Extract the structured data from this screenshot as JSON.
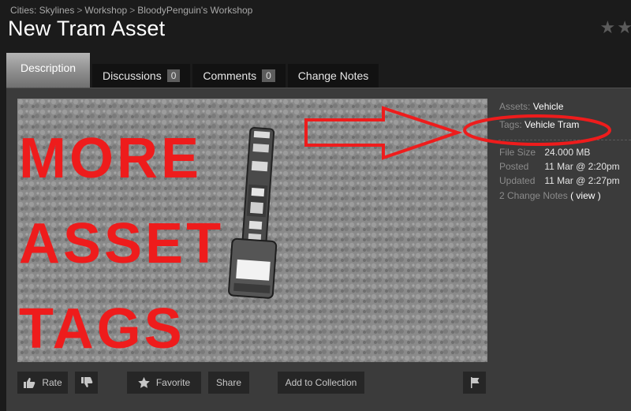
{
  "breadcrumb": {
    "game": "Cities: Skylines",
    "workshop": "Workshop",
    "author_workshop": "BloodyPenguin's Workshop",
    "separator": ">"
  },
  "page_title": "New Tram Asset",
  "rating": {
    "stars": "★★"
  },
  "tabs": [
    {
      "label": "Description",
      "active": true
    },
    {
      "label": "Discussions",
      "count": "0"
    },
    {
      "label": "Comments",
      "count": "0"
    },
    {
      "label": "Change Notes"
    }
  ],
  "overlay_text": [
    "MORE",
    "ASSET",
    "TAGS"
  ],
  "details": {
    "assets_label": "Assets:",
    "assets_value": "Vehicle",
    "tags_label": "Tags:",
    "tags": [
      "Vehicle",
      "Tram"
    ],
    "file_size_label": "File Size",
    "file_size": "24.000 MB",
    "posted_label": "Posted",
    "posted": "11 Mar @ 2:20pm",
    "updated_label": "Updated",
    "updated": "11 Mar @ 2:27pm",
    "change_notes_text": "2 Change Notes",
    "view_open": "(",
    "view_label": "view",
    "view_close": ")"
  },
  "buttons": {
    "rate": "Rate",
    "favorite": "Favorite",
    "share": "Share",
    "add_to_collection": "Add to Collection"
  },
  "icons": [
    "thumbs-up-icon",
    "thumbs-down-icon",
    "star-icon",
    "flag-icon"
  ],
  "colors": {
    "annotation_red": "#ee1c1c",
    "background": "#1b1b1b",
    "panel": "#3b3b3b"
  }
}
